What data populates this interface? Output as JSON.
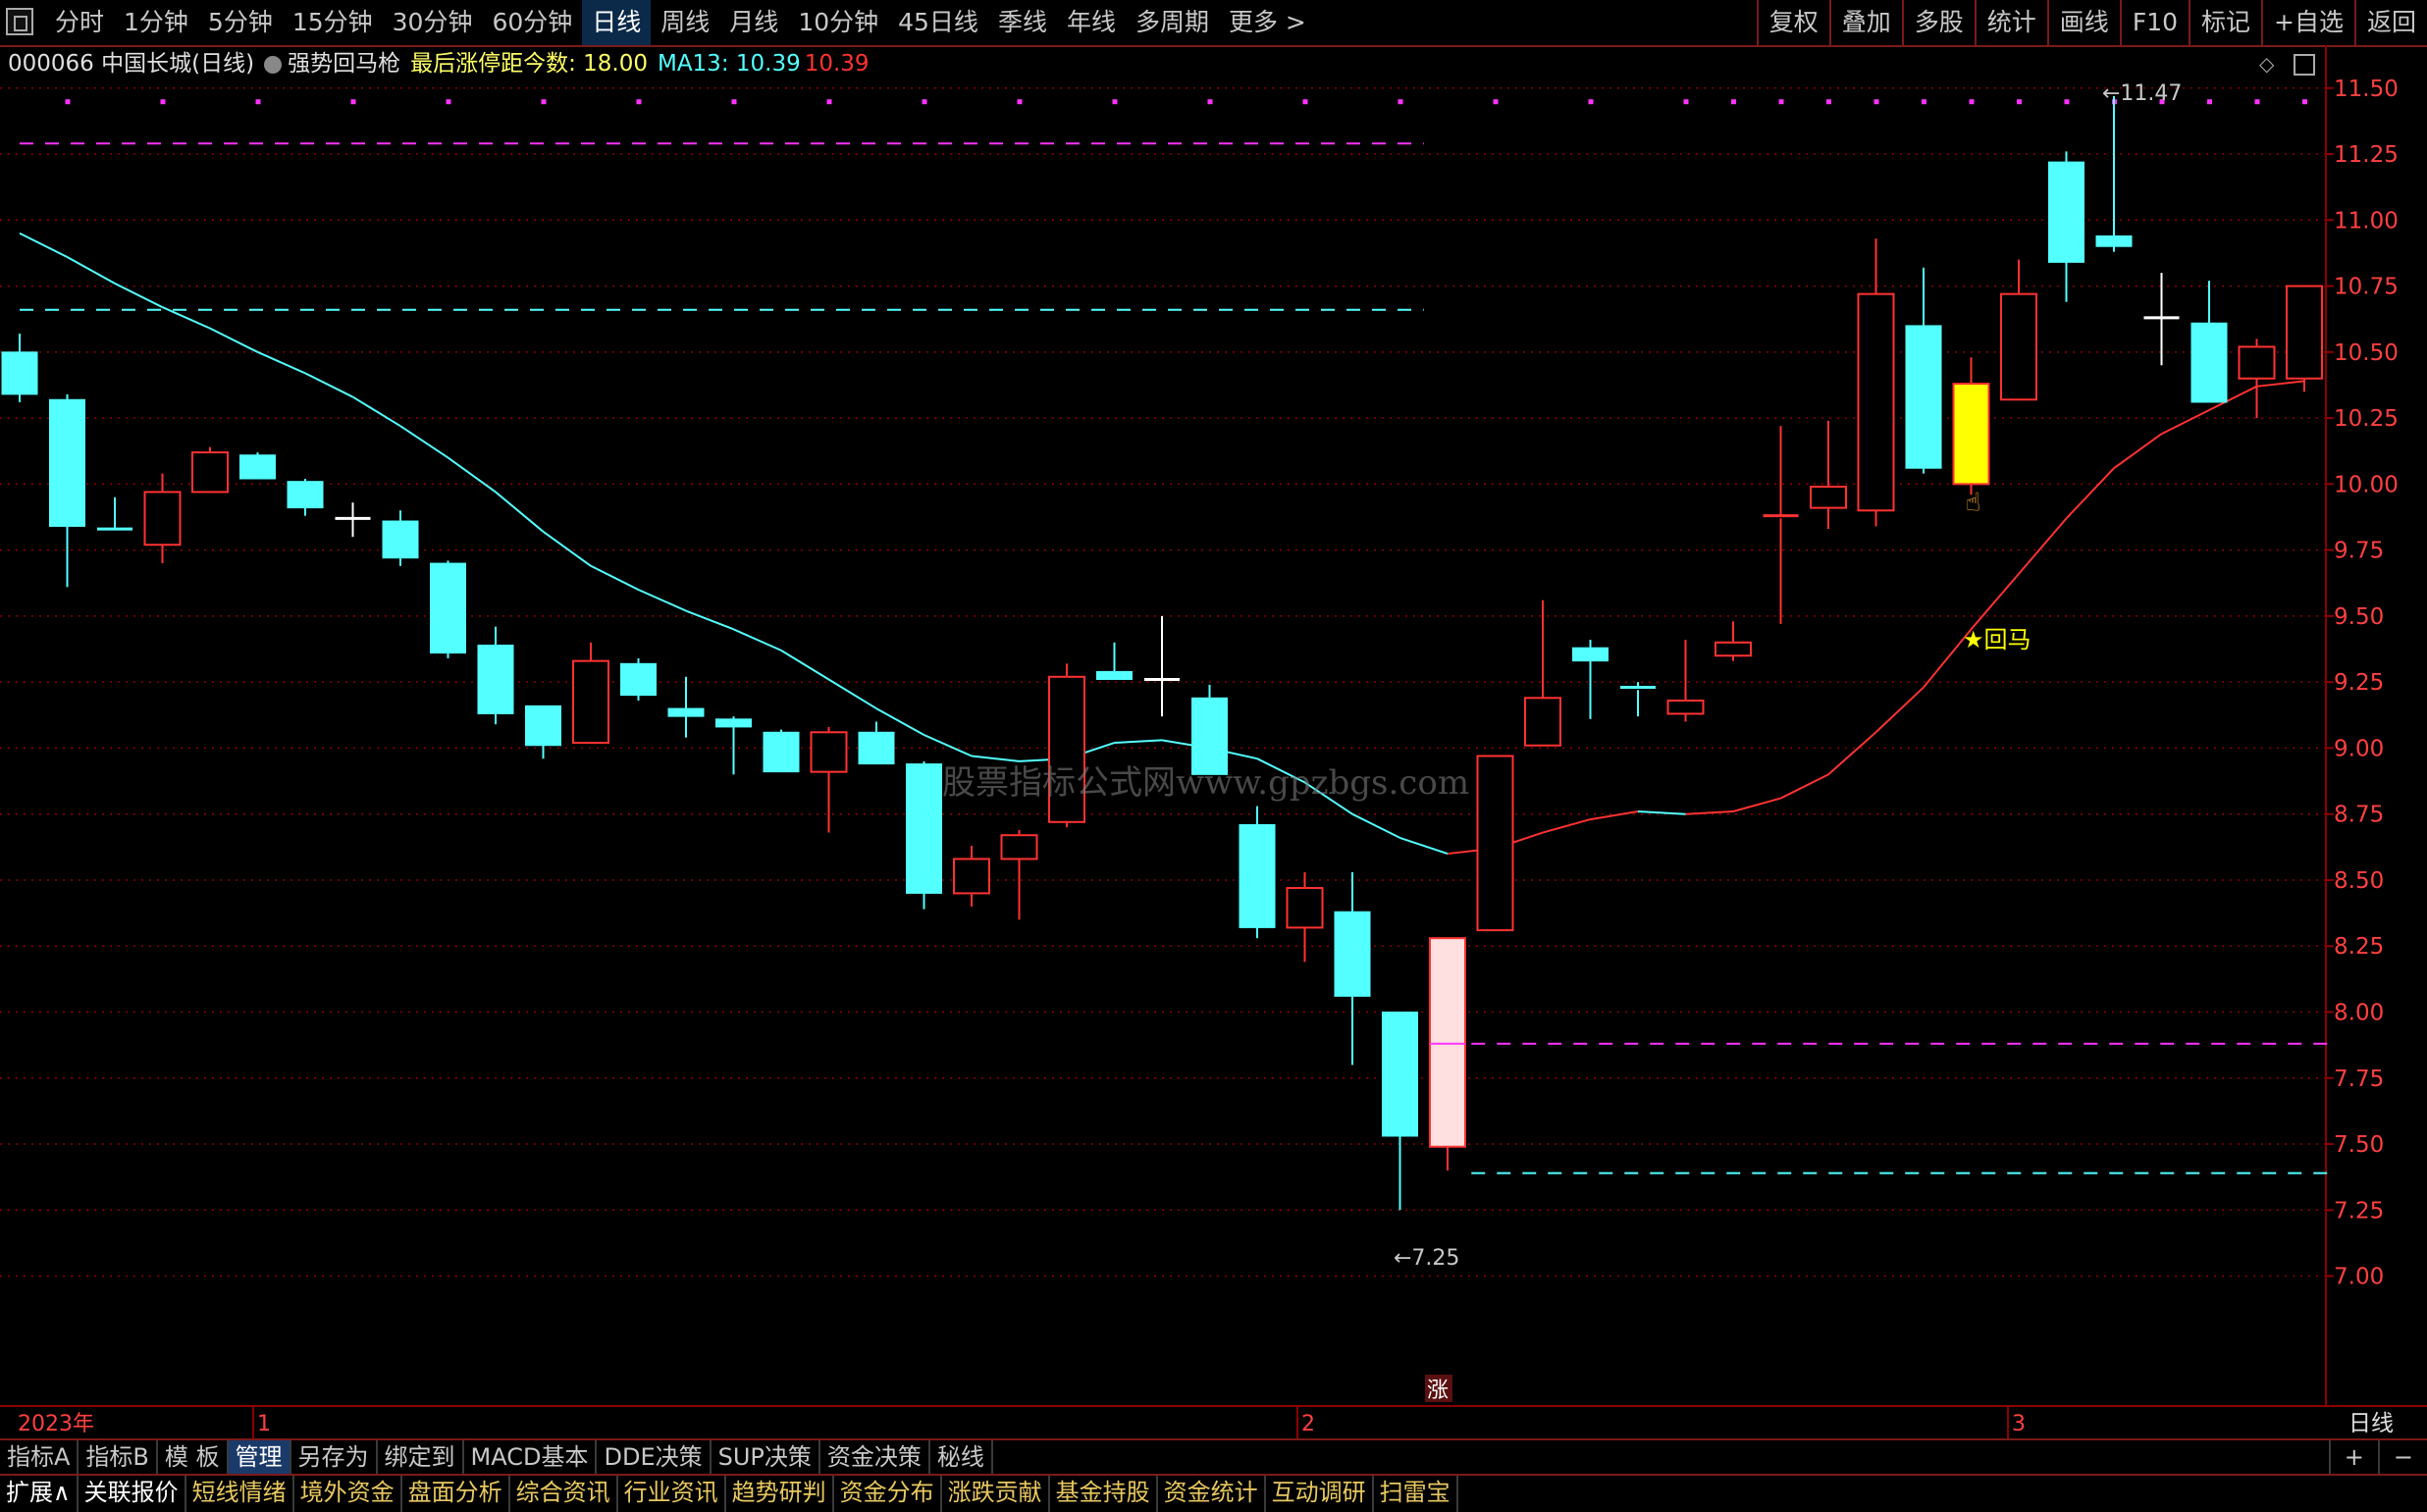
{
  "toolbar": {
    "periods": [
      "分时",
      "1分钟",
      "5分钟",
      "15分钟",
      "30分钟",
      "60分钟",
      "日线",
      "周线",
      "月线",
      "10分钟",
      "45日线",
      "季线",
      "年线",
      "多周期",
      "更多 >"
    ],
    "active_period": "日线",
    "tools": [
      "复权",
      "叠加",
      "多股",
      "统计",
      "画线",
      "F10",
      "标记",
      "+自选",
      "返回"
    ]
  },
  "info": {
    "stock": "000066 中国长城(日线)",
    "indicator": "强势回马枪",
    "limit_label": "最后涨停距今数: 18.00",
    "ma_label": "MA13: 10.39",
    "ma_value2": "10.39"
  },
  "watermark": "股票指标公式网www.gpzbgs.com",
  "annotations": {
    "high_label": "←11.47",
    "low_label": "←7.25",
    "signal_label": "★回马",
    "limit_mark": "涨",
    "period_badge": "日线"
  },
  "colors": {
    "up": "#ff3232",
    "down": "#54ffff",
    "ma": "#54ffff",
    "ma_up": "#ff3232",
    "magenta": "#ff32ff",
    "grid": "#8b0000",
    "signal": "#ffff00",
    "pink": "#ffe0e0"
  },
  "chart_data": {
    "type": "candlestick",
    "y_ticks": [
      "11.50",
      "11.25",
      "11.00",
      "10.75",
      "10.50",
      "10.25",
      "10.00",
      "9.75",
      "9.50",
      "9.25",
      "9.00",
      "8.75",
      "8.50",
      "8.25",
      "8.00",
      "7.75",
      "7.50",
      "7.25",
      "7.00"
    ],
    "ylim": [
      6.82,
      11.54
    ],
    "x_labels": [
      "2023年",
      "1",
      "2",
      "3"
    ],
    "candles": [
      {
        "o": 10.5,
        "h": 10.57,
        "l": 10.31,
        "c": 10.34
      },
      {
        "o": 10.32,
        "h": 10.34,
        "l": 9.61,
        "c": 9.84
      },
      {
        "o": 9.83,
        "h": 9.95,
        "l": 9.82,
        "c": 9.82
      },
      {
        "o": 9.77,
        "h": 10.04,
        "l": 9.7,
        "c": 9.97
      },
      {
        "o": 9.97,
        "h": 10.14,
        "l": 9.97,
        "c": 10.12
      },
      {
        "o": 10.11,
        "h": 10.12,
        "l": 10.02,
        "c": 10.02
      },
      {
        "o": 10.01,
        "h": 10.02,
        "l": 9.88,
        "c": 9.91
      },
      {
        "o": 9.87,
        "h": 9.93,
        "l": 9.8,
        "c": 9.87
      },
      {
        "o": 9.86,
        "h": 9.9,
        "l": 9.69,
        "c": 9.72
      },
      {
        "o": 9.7,
        "h": 9.71,
        "l": 9.34,
        "c": 9.36
      },
      {
        "o": 9.39,
        "h": 9.46,
        "l": 9.09,
        "c": 9.13
      },
      {
        "o": 9.16,
        "h": 9.16,
        "l": 8.96,
        "c": 9.01
      },
      {
        "o": 9.02,
        "h": 9.4,
        "l": 9.02,
        "c": 9.33
      },
      {
        "o": 9.32,
        "h": 9.34,
        "l": 9.18,
        "c": 9.2
      },
      {
        "o": 9.15,
        "h": 9.27,
        "l": 9.04,
        "c": 9.12
      },
      {
        "o": 9.11,
        "h": 9.12,
        "l": 8.9,
        "c": 9.08
      },
      {
        "o": 9.06,
        "h": 9.07,
        "l": 8.91,
        "c": 8.91
      },
      {
        "o": 8.91,
        "h": 9.08,
        "l": 8.68,
        "c": 9.06
      },
      {
        "o": 9.06,
        "h": 9.1,
        "l": 8.94,
        "c": 8.94
      },
      {
        "o": 8.94,
        "h": 8.95,
        "l": 8.39,
        "c": 8.45
      },
      {
        "o": 8.45,
        "h": 8.63,
        "l": 8.4,
        "c": 8.58
      },
      {
        "o": 8.58,
        "h": 8.69,
        "l": 8.35,
        "c": 8.67
      },
      {
        "o": 8.72,
        "h": 9.32,
        "l": 8.7,
        "c": 9.27
      },
      {
        "o": 9.29,
        "h": 9.4,
        "l": 9.26,
        "c": 9.26
      },
      {
        "o": 9.26,
        "h": 9.5,
        "l": 9.12,
        "c": 9.26
      },
      {
        "o": 9.19,
        "h": 9.24,
        "l": 8.9,
        "c": 8.9
      },
      {
        "o": 8.71,
        "h": 8.78,
        "l": 8.28,
        "c": 8.32
      },
      {
        "o": 8.32,
        "h": 8.53,
        "l": 8.19,
        "c": 8.47
      },
      {
        "o": 8.38,
        "h": 8.53,
        "l": 7.8,
        "c": 8.06
      },
      {
        "o": 8.0,
        "h": 8.0,
        "l": 7.25,
        "c": 7.53
      },
      {
        "o": 7.49,
        "h": 8.28,
        "l": 7.4,
        "c": 8.28,
        "special": "limit"
      },
      {
        "o": 8.31,
        "h": 8.97,
        "l": 8.31,
        "c": 8.97
      },
      {
        "o": 9.01,
        "h": 9.56,
        "l": 9.01,
        "c": 9.19
      },
      {
        "o": 9.38,
        "h": 9.41,
        "l": 9.11,
        "c": 9.33
      },
      {
        "o": 9.23,
        "h": 9.25,
        "l": 9.12,
        "c": 9.22
      },
      {
        "o": 9.13,
        "h": 9.41,
        "l": 9.1,
        "c": 9.18
      },
      {
        "o": 9.35,
        "h": 9.48,
        "l": 9.33,
        "c": 9.4
      },
      {
        "o": 9.87,
        "h": 10.22,
        "l": 9.47,
        "c": 9.88
      },
      {
        "o": 9.91,
        "h": 10.24,
        "l": 9.83,
        "c": 9.99
      },
      {
        "o": 9.9,
        "h": 10.93,
        "l": 9.84,
        "c": 10.72
      },
      {
        "o": 10.6,
        "h": 10.82,
        "l": 10.04,
        "c": 10.06
      },
      {
        "o": 10.0,
        "h": 10.48,
        "l": 9.96,
        "c": 10.38,
        "special": "signal"
      },
      {
        "o": 10.32,
        "h": 10.85,
        "l": 10.32,
        "c": 10.72
      },
      {
        "o": 11.22,
        "h": 11.26,
        "l": 10.69,
        "c": 10.84
      },
      {
        "o": 10.94,
        "h": 11.47,
        "l": 10.88,
        "c": 10.9
      },
      {
        "o": 10.63,
        "h": 10.8,
        "l": 10.45,
        "c": 10.63
      },
      {
        "o": 10.61,
        "h": 10.77,
        "l": 10.31,
        "c": 10.31
      },
      {
        "o": 10.4,
        "h": 10.55,
        "l": 10.25,
        "c": 10.52
      },
      {
        "o": 10.4,
        "h": 10.75,
        "l": 10.35,
        "c": 10.75
      }
    ],
    "ma13": [
      10.95,
      10.86,
      10.76,
      10.67,
      10.59,
      10.5,
      10.42,
      10.33,
      10.22,
      10.1,
      9.97,
      9.82,
      9.69,
      9.6,
      9.52,
      9.45,
      9.37,
      9.26,
      9.15,
      9.05,
      8.97,
      8.95,
      8.96,
      9.02,
      9.03,
      9.0,
      8.96,
      8.87,
      8.75,
      8.66,
      8.6,
      8.62,
      8.68,
      8.73,
      8.76,
      8.75,
      8.76,
      8.81,
      8.9,
      9.06,
      9.23,
      9.45,
      9.66,
      9.87,
      10.06,
      10.19,
      10.28,
      10.37,
      10.39
    ],
    "levels": [
      {
        "price": 11.29,
        "color": "magenta",
        "from": 0,
        "to": 29.5
      },
      {
        "price": 10.66,
        "color": "cyan",
        "from": 0,
        "to": 29.5
      },
      {
        "price": 7.88,
        "color": "magenta",
        "from": 30.5,
        "to": 48.5
      },
      {
        "price": 7.39,
        "color": "cyan",
        "from": 30.5,
        "to": 48.5
      }
    ],
    "dot_row_price": 11.45
  },
  "bottom": {
    "tabs1": [
      "指标A",
      "指标B",
      "模 板",
      "管理",
      "另存为",
      "绑定到",
      "MACD基本",
      "DDE决策",
      "SUP决策",
      "资金决策",
      "秘线"
    ],
    "active_tab": "管理",
    "ctrl": [
      "+",
      "−"
    ],
    "tabs2": [
      "扩展∧",
      "关联报价",
      "短线情绪",
      "境外资金",
      "盘面分析",
      "综合资讯",
      "行业资讯",
      "趋势研判",
      "资金分布",
      "涨跌贡献",
      "基金持股",
      "资金统计",
      "互动调研",
      "扫雷宝"
    ]
  }
}
